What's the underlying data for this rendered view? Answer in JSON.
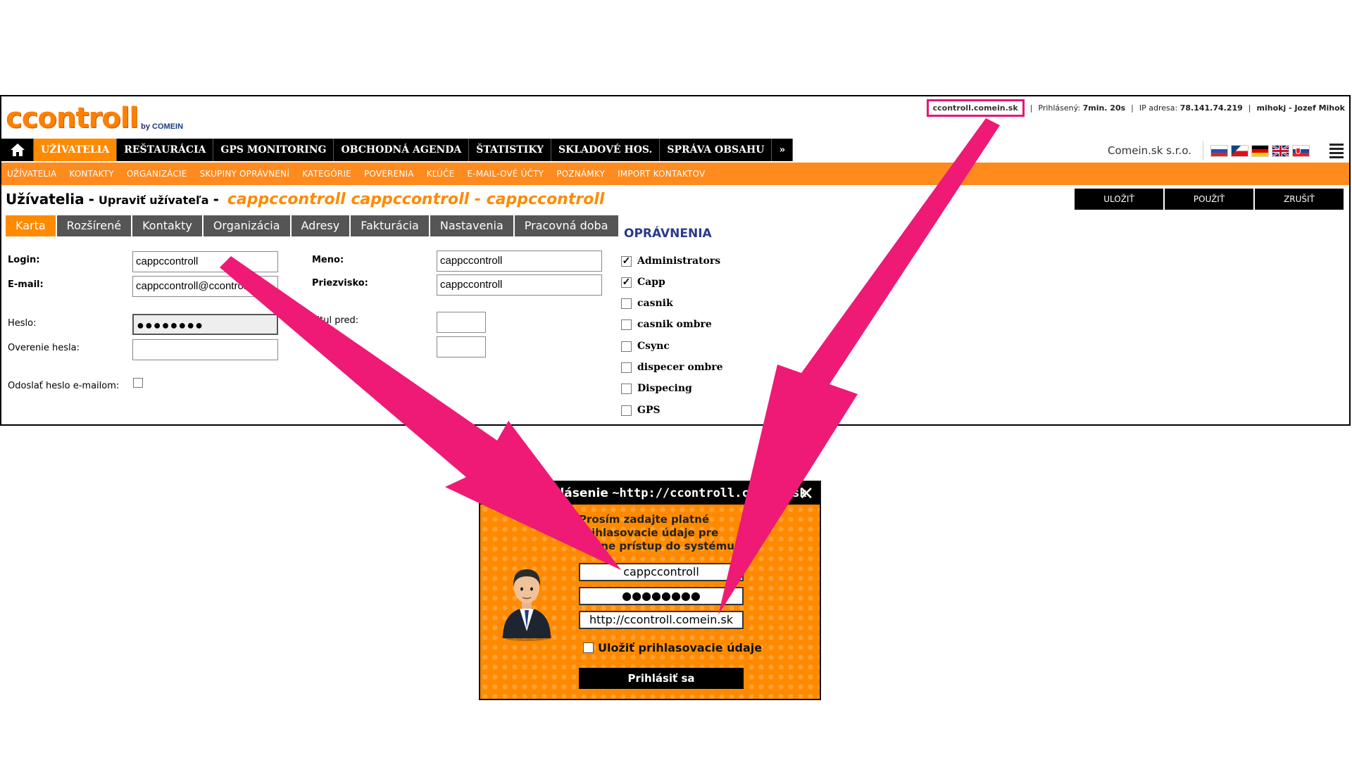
{
  "logo": {
    "main": "ccontroll",
    "by": "by",
    "brand": "COMEIN"
  },
  "session": {
    "host": "ccontroll.comein.sk",
    "logged_label": "Prihlásený:",
    "logged_value": "7min. 20s",
    "ip_label": "IP adresa:",
    "ip_value": "78.141.74.219",
    "user": "mihokj - Jozef Mihok"
  },
  "main_nav": [
    "UŽÍVATELIA",
    "REŠTAURÁCIA",
    "GPS MONITORING",
    "OBCHODNÁ AGENDA",
    "ŠTATISTIKY",
    "SKLADOVÉ HOS.",
    "SPRÁVA OBSAHU",
    "»"
  ],
  "company": "Comein.sk s.r.o.",
  "flags": [
    "ru-flag",
    "cz-flag",
    "de-flag",
    "uk-flag",
    "sk-flag"
  ],
  "sub_nav": [
    "UŽÍVATELIA",
    "KONTAKTY",
    "ORGANIZÁCIE",
    "SKUPINY OPRÁVNENÍ",
    "KATEGÓRIE",
    "POVERENIA",
    "KĽÚČE",
    "E-MAIL-OVÉ ÚČTY",
    "POZNÁMKY",
    "IMPORT KONTAKTOV"
  ],
  "heading": {
    "main": "Užívatelia",
    "dash": "-",
    "sub": "Upraviť užívateľa",
    "dash2": "-",
    "user": "cappccontroll cappccontroll - cappccontroll"
  },
  "actions": [
    "ULOŽIŤ",
    "POUŽIŤ",
    "ZRUŠIŤ"
  ],
  "tabs": [
    "Karta",
    "Rozšírené",
    "Kontakty",
    "Organizácia",
    "Adresy",
    "Fakturácia",
    "Nastavenia",
    "Pracovná doba"
  ],
  "form": {
    "login_label": "Login:",
    "login_value": "cappccontroll",
    "email_label": "E-mail:",
    "email_value": "cappccontroll@ccontroll.me",
    "password_label": "Heslo:",
    "password_value": "●●●●●●●●",
    "password_verify_label": "Overenie hesla:",
    "password_verify_value": "",
    "send_pw_label": "Odoslať heslo e-mailom:",
    "first_name_label": "Meno:",
    "first_name_value": "cappccontroll",
    "last_name_label": "Priezvisko:",
    "last_name_value": "cappccontroll",
    "title_before_label": "Titul pred:",
    "title_before_value": "",
    "title_after_value": ""
  },
  "permissions": {
    "title": "OPRÁVNENIA",
    "items": [
      {
        "label": "Administrators",
        "checked": "✓"
      },
      {
        "label": "Capp",
        "checked": "✓"
      },
      {
        "label": "casnik",
        "checked": ""
      },
      {
        "label": "casnik ombre",
        "checked": ""
      },
      {
        "label": "Csync",
        "checked": ""
      },
      {
        "label": "dispecer ombre",
        "checked": ""
      },
      {
        "label": "Dispecing",
        "checked": ""
      },
      {
        "label": "GPS",
        "checked": ""
      }
    ]
  },
  "dialog": {
    "title_prefix": "C",
    "title": "Prihlásenie",
    "title_url": "~http://ccontroll.comein.sk",
    "message": "Prosím zadajte platné prihlasovacie údaje pre online prístup do systému",
    "username": "cappccontroll",
    "password": "●●●●●●●●",
    "server": "http://ccontroll.comein.sk",
    "remember_label": "Uložiť prihlasovacie údaje",
    "login_button": "Prihlásiť sa",
    "close": "✕"
  },
  "colors": {
    "accent": "#ff8a00",
    "nav": "#000000",
    "highlight": "#e8157a",
    "perm_title": "#2a3a8c"
  }
}
